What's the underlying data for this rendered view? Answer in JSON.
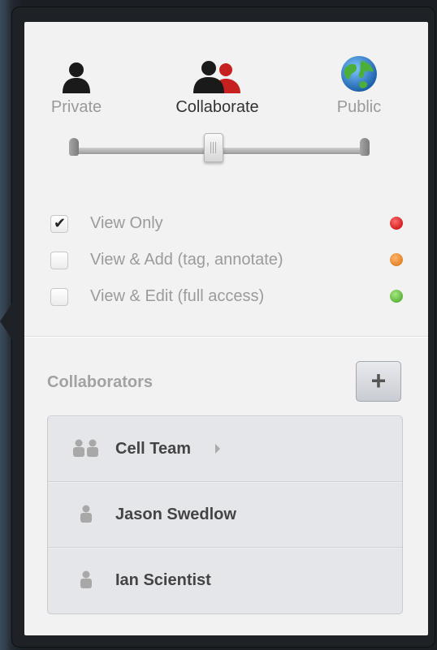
{
  "sharing": {
    "levels": [
      {
        "label": "Private",
        "icon": "single-person-icon",
        "color": "#1a1a1a"
      },
      {
        "label": "Collaborate",
        "icon": "group-people-icon",
        "color": "#c62020"
      },
      {
        "label": "Public",
        "icon": "globe-icon",
        "color": "#3a8fd6"
      }
    ],
    "selected": "Collaborate"
  },
  "permissions": [
    {
      "label": "View Only",
      "checked": true,
      "color": "#d31f1f"
    },
    {
      "label": "View & Add (tag, annotate)",
      "checked": false,
      "color": "#e0842a"
    },
    {
      "label": "View & Edit (full access)",
      "checked": false,
      "color": "#5fb43c"
    }
  ],
  "collaborators": {
    "title": "Collaborators",
    "add_label": "+",
    "items": [
      {
        "name": "Cell Team",
        "icon": "group-icon"
      },
      {
        "name": "Jason Swedlow",
        "icon": "person-icon"
      },
      {
        "name": "Ian Scientist",
        "icon": "person-icon"
      }
    ]
  }
}
